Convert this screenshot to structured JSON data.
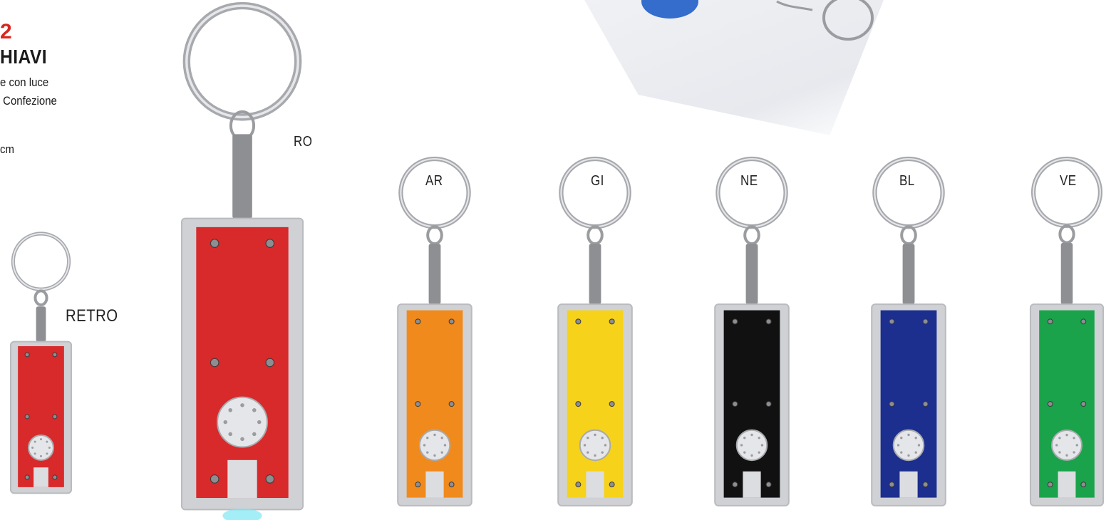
{
  "header": {
    "code": "2",
    "title": "HIAVI",
    "description_lines": [
      "e con luce",
      " Confezione"
    ],
    "size": "cm"
  },
  "variants": [
    {
      "code": "RETRO",
      "color": "#d8292b"
    },
    {
      "code": "RO",
      "color": "#d8292b"
    },
    {
      "code": "AR",
      "color": "#f08a1c"
    },
    {
      "code": "GI",
      "color": "#f6d21a"
    },
    {
      "code": "NE",
      "color": "#111111"
    },
    {
      "code": "BL",
      "color": "#1c2e8e"
    },
    {
      "code": "VE",
      "color": "#1aa34a"
    }
  ]
}
